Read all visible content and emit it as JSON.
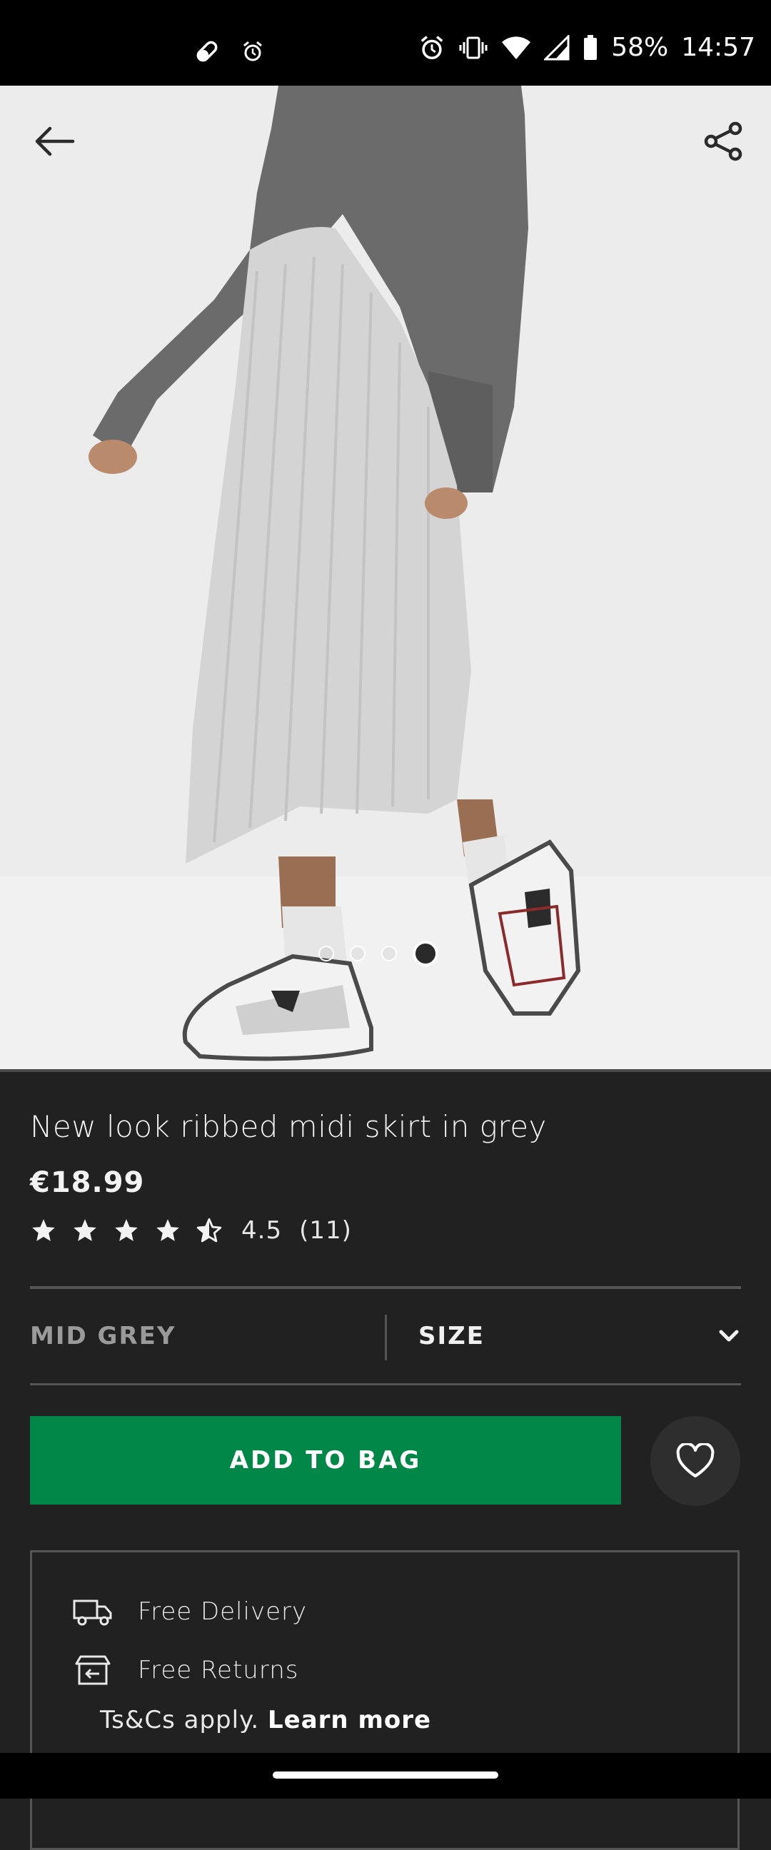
{
  "status_bar": {
    "battery": "58%",
    "time": "14:57"
  },
  "product": {
    "title": "New look ribbed midi skirt in grey",
    "price": "€18.99",
    "rating": {
      "stars": 4.5,
      "value": "4.5",
      "count": "(11)"
    },
    "image_carousel": {
      "total": 4,
      "active_index": 4
    }
  },
  "options": {
    "colour": "MID GREY",
    "size_label": "SIZE"
  },
  "actions": {
    "add_to_bag": "ADD TO BAG"
  },
  "delivery": {
    "free_delivery": "Free Delivery",
    "free_returns": "Free Returns",
    "tcs_text": "Ts&Cs apply.",
    "learn_more": "Learn more"
  },
  "colors": {
    "add_to_bag": "#018849",
    "background": "#212121"
  }
}
